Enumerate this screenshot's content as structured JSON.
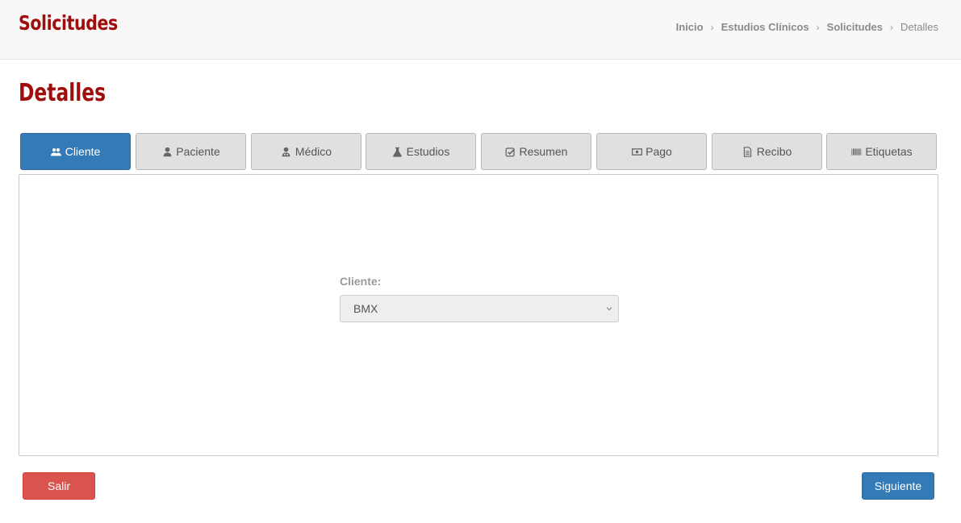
{
  "header": {
    "app_title": "Solicitudes",
    "breadcrumb": [
      {
        "label": "Inicio"
      },
      {
        "label": "Estudios Clínicos"
      },
      {
        "label": "Solicitudes"
      },
      {
        "label": "Detalles"
      }
    ]
  },
  "page": {
    "title": "Detalles"
  },
  "tabs": [
    {
      "label": "Cliente",
      "icon": "users-icon",
      "active": true
    },
    {
      "label": "Paciente",
      "icon": "user-icon",
      "active": false
    },
    {
      "label": "Médico",
      "icon": "doctor-icon",
      "active": false
    },
    {
      "label": "Estudios",
      "icon": "flask-icon",
      "active": false
    },
    {
      "label": "Resumen",
      "icon": "check-square-icon",
      "active": false
    },
    {
      "label": "Pago",
      "icon": "money-icon",
      "active": false
    },
    {
      "label": "Recibo",
      "icon": "file-text-icon",
      "active": false
    },
    {
      "label": "Etiquetas",
      "icon": "barcode-icon",
      "active": false
    }
  ],
  "form": {
    "cliente_label": "Cliente:",
    "cliente_value": "BMX"
  },
  "actions": {
    "exit_label": "Salir",
    "next_label": "Siguiente"
  },
  "colors": {
    "brand": "#a00d0d",
    "primary": "#337ab7",
    "danger": "#d9534f"
  }
}
